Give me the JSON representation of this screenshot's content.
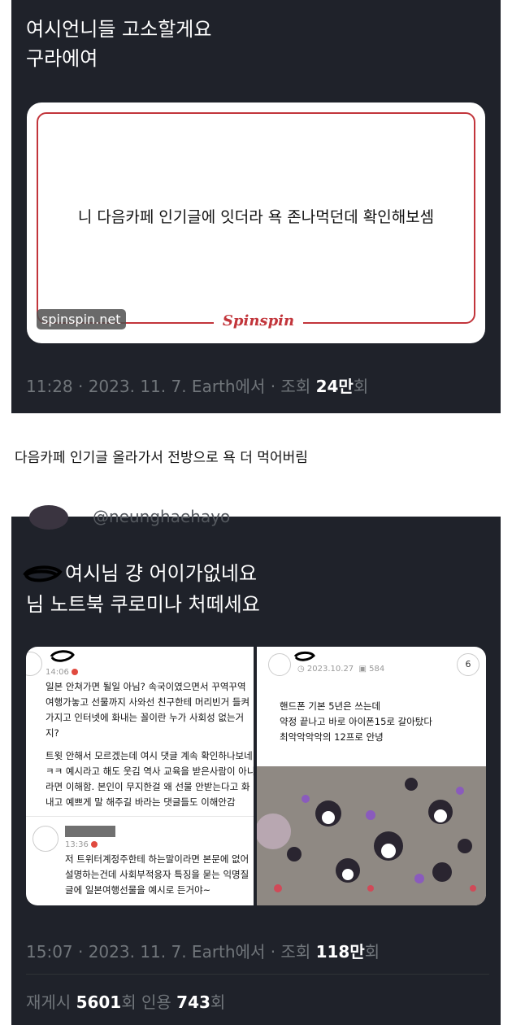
{
  "tweet1": {
    "text_lines": [
      "여시언니들 고소할게요",
      "구라에여"
    ],
    "card": {
      "message": "니 다음카페 인기글에 잇더라 욕 존나먹던데 확인해보셈",
      "watermark": "spinspin.net",
      "logo": "Spinspin"
    },
    "meta": {
      "prefix": "11:28 · 2023. 11. 7. Earth에서 · 조회 ",
      "count": "24만",
      "suffix": "회"
    }
  },
  "caption": "다음카페 인기글 올라가서 전방으로 욕 더 먹어버림",
  "tweet2": {
    "handle_partial": "@neunghaehayo",
    "text_lines": [
      "여시님 걍 어이가없네요",
      "님 노트북 쿠로미나 처떼세요"
    ],
    "left_image": {
      "time1": "14:06",
      "para1": [
        "일본 안쳐가면 될일 아님? 속국이였으면서 꾸역꾸역",
        "여행가놓고 선물까지 사와선 친구한테 머리빈거 들켜",
        "가지고 인터넷에 화내는 꼴이란 누가 사회성 없는거",
        "지?"
      ],
      "para2": [
        "트윗 안해서 모르겠는데 여시 댓글 계속 확인하나보네",
        "ㅋㅋ 예시라고 해도 웃김 역사 교육을 받은사람이 아니",
        "라면 이해함. 본인이 무지한걸 왜 선물 안받는다고 화",
        "내고 예쁘게 말 해주길 바라는 댓글들도 이해안감"
      ],
      "time2": "13:36",
      "para3": [
        "저 트위터계정주한테 하는말이라면 본문에 없어",
        "설명하는건데 사회부적응자 특징을 묻는 익명질",
        "글에 일본여행선물을 예시로 든거야~"
      ]
    },
    "right_image": {
      "date": "2023.10.27",
      "views": "584",
      "badge": "6",
      "lines": [
        "핸드폰 기본 5년은 쓰는데",
        "약정 끝나고 바로 아이폰15로 갈아탔다",
        "최악악악악의 12프로 안녕"
      ]
    },
    "meta": {
      "prefix": "15:07 · 2023. 11. 7. Earth에서 · 조회 ",
      "count": "118만",
      "suffix": "회"
    },
    "stats": {
      "retweet_label": "재게시 ",
      "retweet_count": "5601",
      "retweet_unit": "회",
      "quote_label": " 인용 ",
      "quote_count": "743",
      "quote_unit": "회"
    }
  },
  "colors": {
    "tweet_bg": "#1f222a",
    "meta_grey": "#71767b",
    "card_red": "#c2353b"
  }
}
